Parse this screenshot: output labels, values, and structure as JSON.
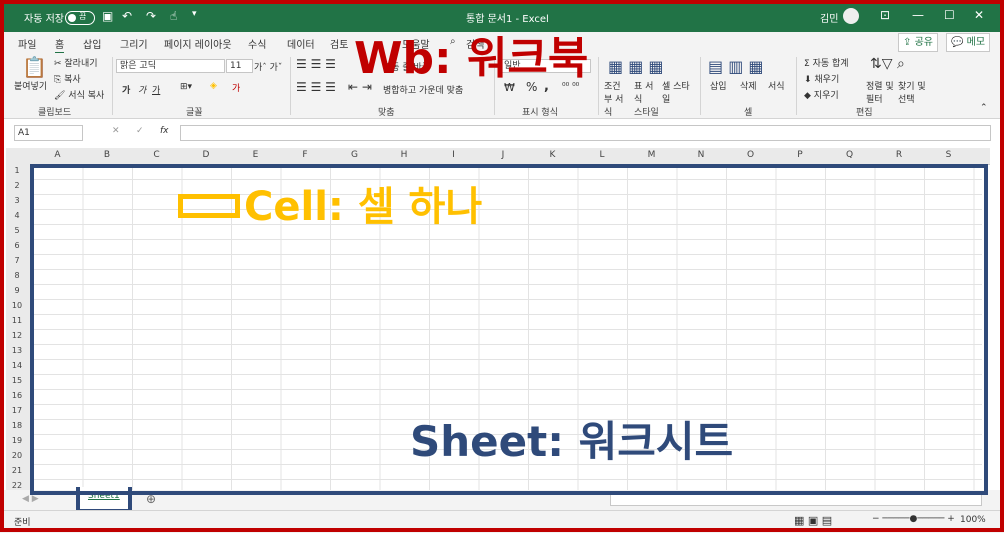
{
  "titlebar": {
    "autosave_label": "자동 저장",
    "autosave_state": "끔",
    "document_title": "통합 문서1 - Excel",
    "user_name": "김민",
    "bg_color": "#217346"
  },
  "tabs": [
    "파일",
    "홈",
    "삽입",
    "그리기",
    "페이지 레이아웃",
    "수식",
    "데이터",
    "검토",
    "보기",
    "도움말"
  ],
  "tell_me": "검색",
  "share_label": "공유",
  "memo_label": "메모",
  "ribbon": {
    "clipboard": {
      "paste": "붙여넣기",
      "cut": "잘라내기",
      "copy": "복사",
      "format_painter": "서식 복사",
      "group": "클립보드"
    },
    "font": {
      "name": "맑은 고딕",
      "size": "11",
      "bold": "가",
      "italic": "가",
      "underline": "가",
      "group": "글꼴"
    },
    "align": {
      "wrap": "자동 줄 바꿈",
      "merge": "병합하고 가운데 맞춤",
      "group": "맞춤"
    },
    "number": {
      "format": "일반",
      "percent": "%",
      "comma": ",",
      "group": "표시 형식"
    },
    "styles": {
      "cond": "조건부 서식",
      "table": "표 서식",
      "cell": "셀 스타일",
      "group": "스타일"
    },
    "cells": {
      "insert": "삽입",
      "delete": "삭제",
      "format": "서식",
      "group": "셀"
    },
    "edit": {
      "autosum": "자동 합계",
      "fill": "채우기",
      "clear": "지우기",
      "sort": "정렬 및 필터",
      "find": "찾기 및 선택",
      "group": "편집"
    }
  },
  "formula_bar": {
    "name_box": "A1",
    "fx": "fx",
    "value": ""
  },
  "columns": [
    "A",
    "B",
    "C",
    "D",
    "E",
    "F",
    "G",
    "H",
    "I",
    "J",
    "K",
    "L",
    "M",
    "N",
    "O",
    "P",
    "Q",
    "R",
    "S"
  ],
  "rows": [
    "1",
    "2",
    "3",
    "4",
    "5",
    "6",
    "7",
    "8",
    "9",
    "10",
    "11",
    "12",
    "13",
    "14",
    "15",
    "16",
    "17",
    "18",
    "19",
    "20",
    "21",
    "22"
  ],
  "sheet_tab": "Sheet1",
  "status": {
    "ready": "준비",
    "zoom": "100%"
  },
  "annotations": {
    "workbook": "Wb: 워크북",
    "cell": "Cell: 셀 하나",
    "sheet": "Sheet: 워크시트",
    "workbook_color": "#c00000",
    "cell_color": "#ffc000",
    "sheet_color": "#2f4a7a"
  }
}
